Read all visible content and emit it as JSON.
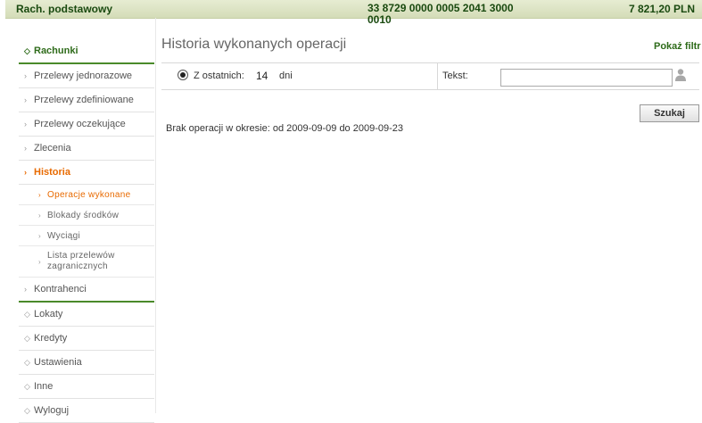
{
  "account": {
    "name": "Rach. podstawowy",
    "number": "33 8729 0000 0005 2041 3000 0010",
    "balance": "7 821,20 PLN"
  },
  "sidebar": {
    "items": [
      {
        "label": "Rachunki"
      },
      {
        "label": "Przelewy jednorazowe"
      },
      {
        "label": "Przelewy zdefiniowane"
      },
      {
        "label": "Przelewy oczekujące"
      },
      {
        "label": "Zlecenia"
      },
      {
        "label": "Historia"
      },
      {
        "label": "Kontrahenci"
      },
      {
        "label": "Lokaty"
      },
      {
        "label": "Kredyty"
      },
      {
        "label": "Ustawienia"
      },
      {
        "label": "Inne"
      },
      {
        "label": "Wyloguj"
      }
    ],
    "history_sub": [
      {
        "label": "Operacje wykonane"
      },
      {
        "label": "Blokady środków"
      },
      {
        "label": "Wyciągi"
      },
      {
        "label": "Lista przelewów zagranicznych"
      }
    ]
  },
  "main": {
    "title": "Historia wykonanych operacji",
    "show_filter": "Pokaż filtr",
    "filter": {
      "last_label": "Z ostatnich:",
      "days_value": "14",
      "days_unit": "dni",
      "text_label": "Tekst:",
      "text_value": ""
    },
    "search_button": "Szukaj",
    "no_operations": "Brak operacji w okresie: od 2009-09-09 do 2009-09-23"
  },
  "colors": {
    "accent_green": "#2e6b1a",
    "accent_orange": "#e86a00",
    "bar": "#d4dcb8"
  }
}
